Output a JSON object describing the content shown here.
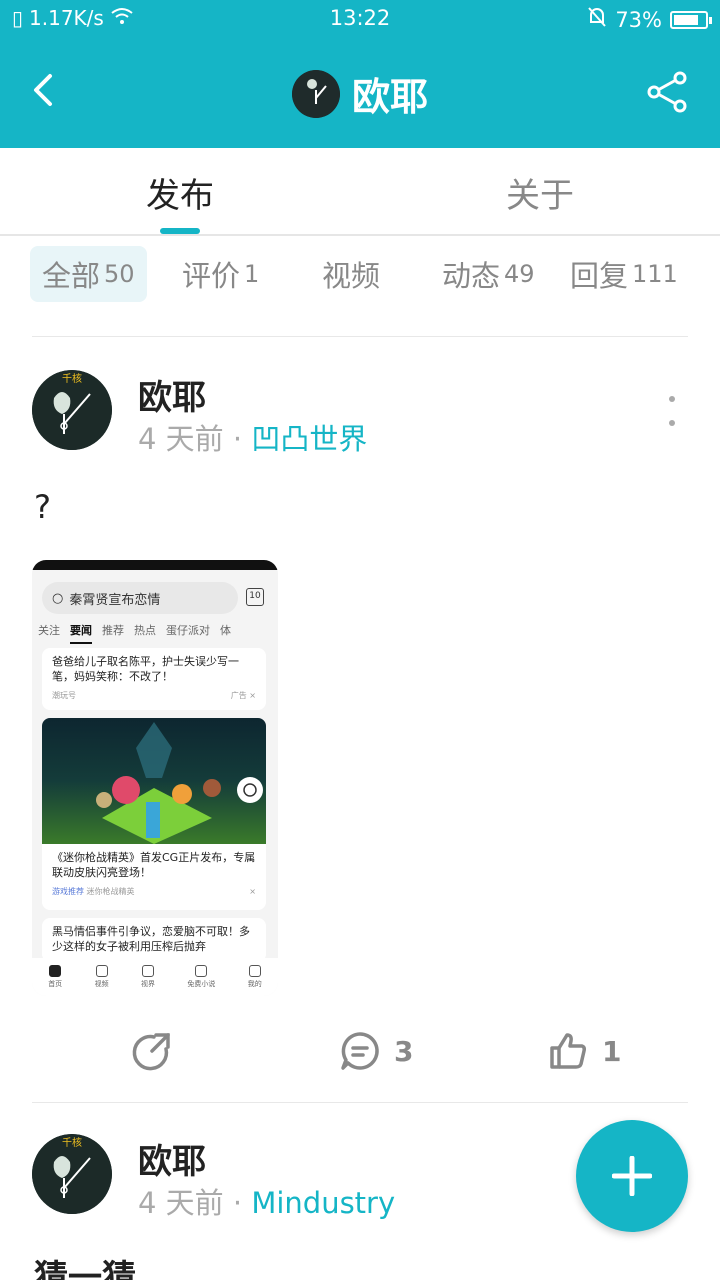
{
  "status_bar": {
    "network_speed": "1.17K/s",
    "time": "13:22",
    "battery": "73%"
  },
  "header": {
    "title": "欧耶",
    "avatar_icon": "avatar-icon",
    "back_icon": "chevron-left-icon",
    "share_icon": "share-icon"
  },
  "tabs": [
    {
      "label": "发布",
      "active": true
    },
    {
      "label": "关于",
      "active": false
    }
  ],
  "filters": [
    {
      "label": "全部",
      "count": "50",
      "active": true
    },
    {
      "label": "评价",
      "count": "1",
      "active": false
    },
    {
      "label": "视频",
      "count": "",
      "active": false
    },
    {
      "label": "动态",
      "count": "49",
      "active": false
    },
    {
      "label": "回复",
      "count": "111",
      "active": false
    }
  ],
  "posts": [
    {
      "author": "欧耶",
      "time": "4 天前",
      "separator": " · ",
      "topic": "凹凸世界",
      "text": "?",
      "image": {
        "search_text": "秦霄贤宣布恋情",
        "calendar_num": "10",
        "subtabs": [
          "关注",
          "要闻",
          "推荐",
          "热点",
          "蛋仔派对",
          "体"
        ],
        "card1_title": "爸爸给儿子取名陈平，护士失误少写一笔，妈妈笑称：不改了！",
        "card1_source": "潮玩号",
        "card1_ad": "广告 ×",
        "card2_title": "《迷你枪战精英》首发CG正片发布，专属联动皮肤闪亮登场！",
        "card2_tag": "游戏推荐",
        "card2_source": "迷你枪战精英",
        "card3_title": "黑马情侣事件引争议，恋爱脑不可取！多少这样的女子被利用压榨后抛弃",
        "nav": [
          "首页",
          "视频",
          "视界",
          "免费小说",
          "我的"
        ]
      },
      "share_icon": "share-arrow-icon",
      "comments": "3",
      "likes": "1"
    },
    {
      "author": "欧耶",
      "time": "4 天前",
      "separator": " · ",
      "topic": "Mindustry",
      "text": "猜一猜"
    }
  ],
  "fab_icon": "plus-icon",
  "colors": {
    "accent": "#15b5c6"
  }
}
